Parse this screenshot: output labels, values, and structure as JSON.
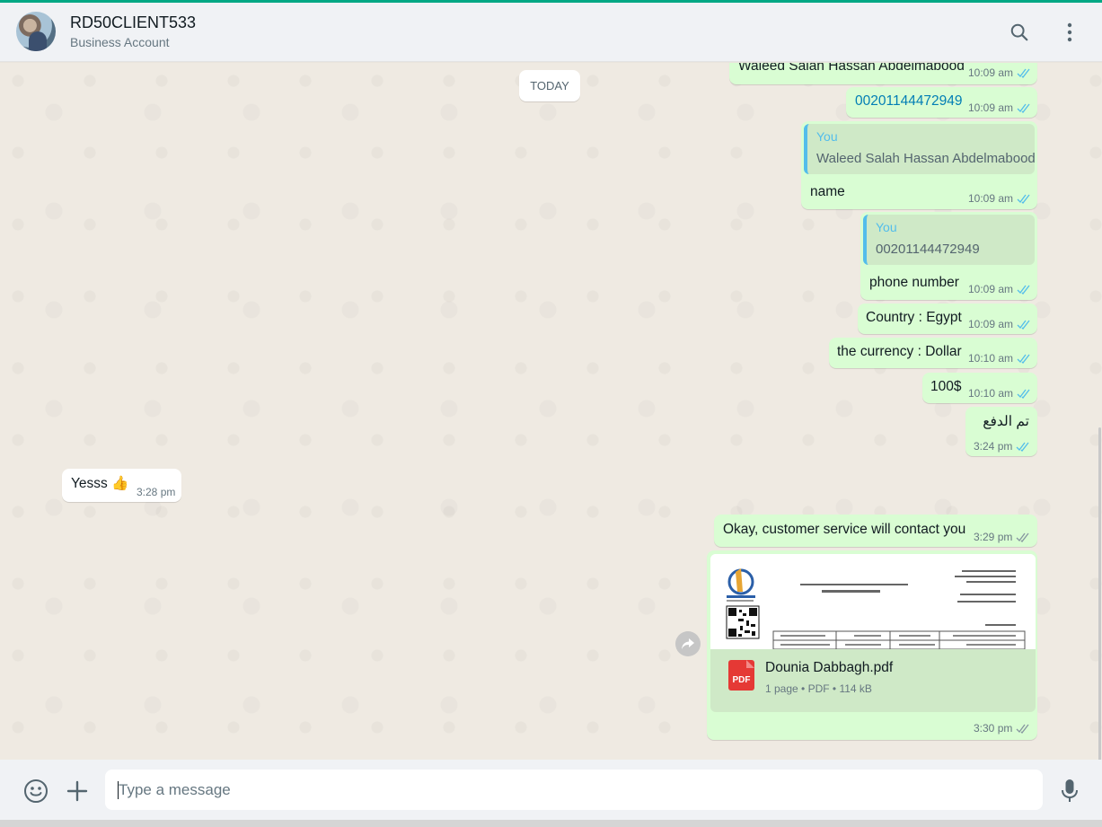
{
  "header": {
    "title": "RD50CLIENT533",
    "subtitle": "Business Account",
    "icons": [
      "search-icon",
      "menu-icon"
    ]
  },
  "chat": {
    "day_label": "TODAY",
    "messages": [
      {
        "text": "Waleed Salah Hassan Abdelmabood",
        "time": "10:09 am"
      },
      {
        "text": "00201144472949",
        "time": "10:09 am"
      },
      {
        "quote_name": "You",
        "quote_text": "Waleed Salah Hassan Abdelmabood",
        "text": "name",
        "time": "10:09 am"
      },
      {
        "quote_name": "You",
        "quote_text": "00201144472949",
        "text": "phone number",
        "time": "10:09 am"
      },
      {
        "text": "Country : Egypt",
        "time": "10:09 am"
      },
      {
        "text": "the currency : Dollar",
        "time": "10:10 am"
      },
      {
        "text": "100$",
        "time": "10:10 am"
      },
      {
        "text": "تم الدفع",
        "time": "3:24 pm"
      },
      {
        "text": "Yesss 👍",
        "time": "3:28 pm"
      },
      {
        "text": "Okay, customer service will contact you",
        "time": "3:29 pm"
      },
      {
        "file_name": "Dounia Dabbagh.pdf",
        "file_info": "1 page • PDF • 114 kB",
        "file_type": "PDF",
        "time": "3:30 pm"
      }
    ]
  },
  "composer": {
    "placeholder": "Type a message",
    "icons": [
      "emoji-icon",
      "plus-icon",
      "mic-icon"
    ]
  },
  "colors": {
    "accent": "#00a884",
    "outgoing_bubble": "#d9fdd3",
    "incoming_bubble": "#ffffff",
    "read_tick": "#53bdeb",
    "pdf_red": "#e53935"
  }
}
